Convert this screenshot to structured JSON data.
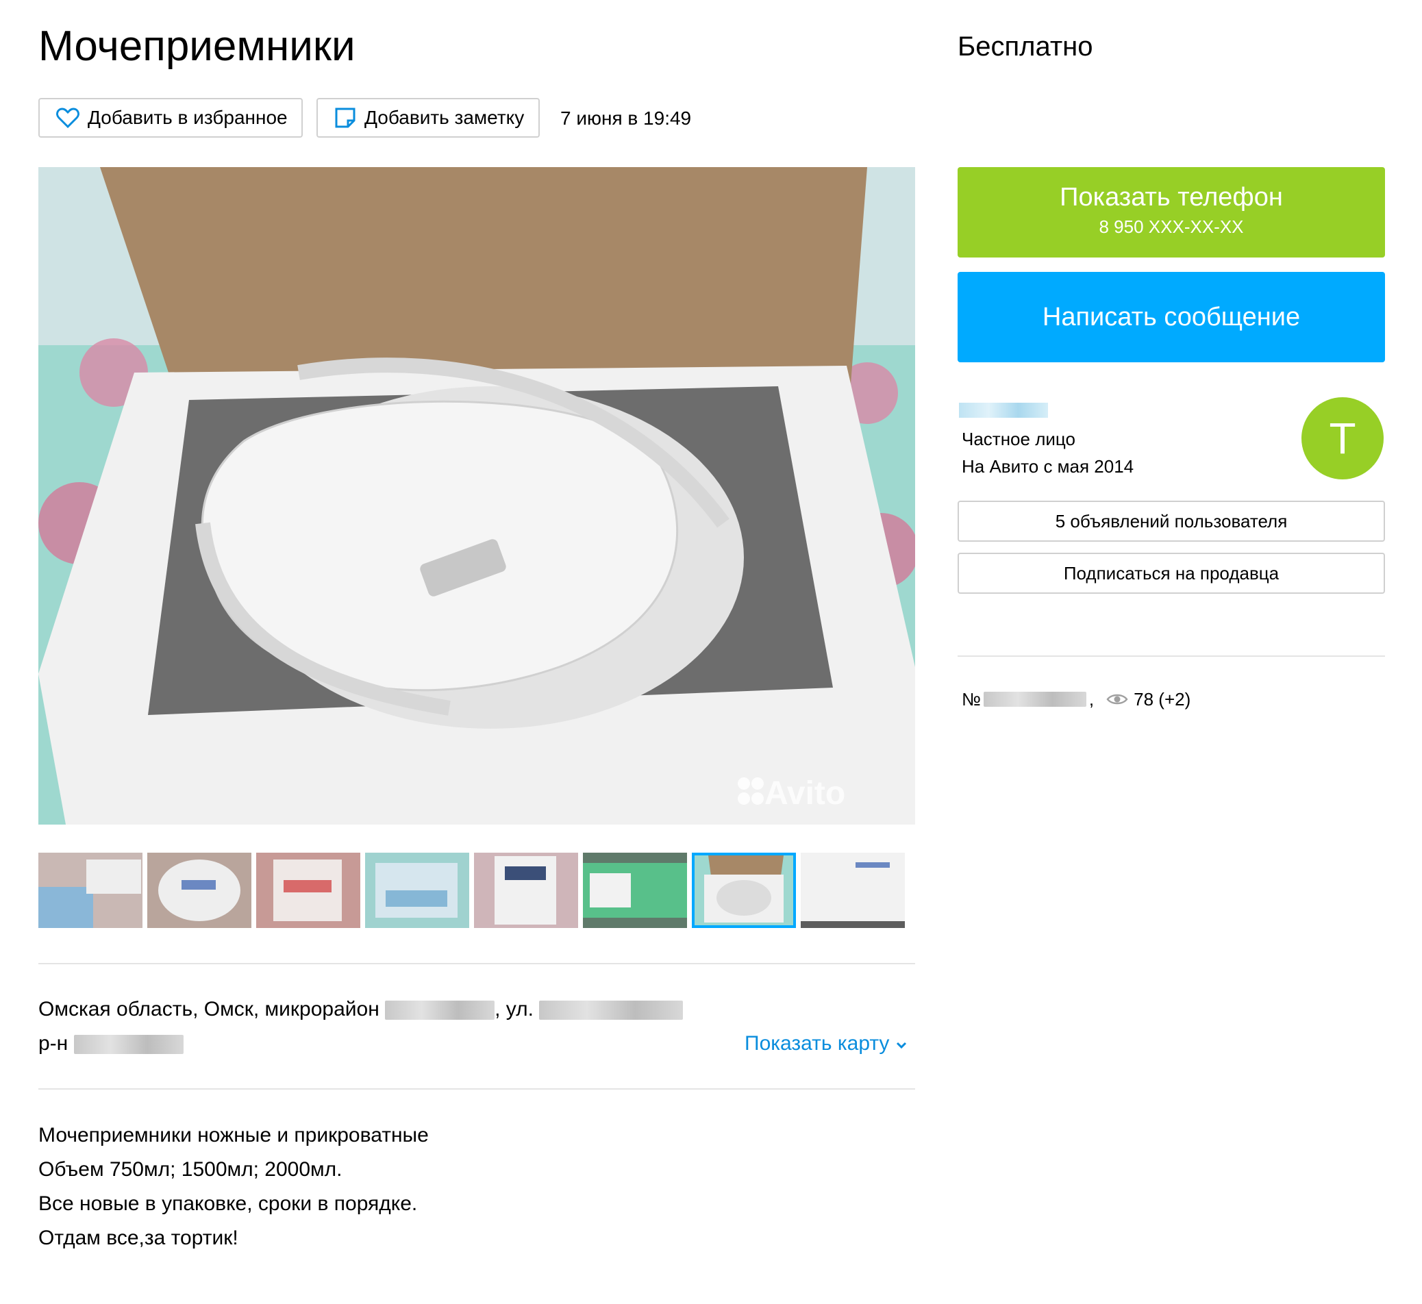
{
  "listing": {
    "title": "Мочеприемники",
    "price": "Бесплатно",
    "date": "7 июня в 19:49",
    "favorite_label": "Добавить в избранное",
    "note_label": "Добавить заметку"
  },
  "photo": {
    "watermark": "Avito",
    "thumbnail_count": 8,
    "active_thumbnail": 7
  },
  "contact": {
    "phone_label": "Показать телефон",
    "phone_masked": "8 950 XXX-XX-XX",
    "message_label": "Написать сообщение"
  },
  "seller": {
    "type": "Частное лицо",
    "since": "На Авито с мая 2014",
    "avatar_letter": "T",
    "ads_button": "5 объявлений пользователя",
    "subscribe_button": "Подписаться на продавца"
  },
  "meta": {
    "number_prefix": "№",
    "views": "78 (+2)"
  },
  "address": {
    "line1_a": "Омская область, Омск, микрорайон",
    "line1_b": ", ул.",
    "line2_prefix": "р-н",
    "show_map": "Показать карту"
  },
  "description": [
    "Мочеприемники ножные и прикроватные",
    "Объем 750мл; 1500мл; 2000мл.",
    "Все новые в упаковке, сроки в порядке.",
    "Отдам все,за тортик!"
  ],
  "colors": {
    "phone_button": "#97cf26",
    "message_button": "#00aaff",
    "link": "#0a8ddd",
    "avatar": "#97cf26"
  }
}
